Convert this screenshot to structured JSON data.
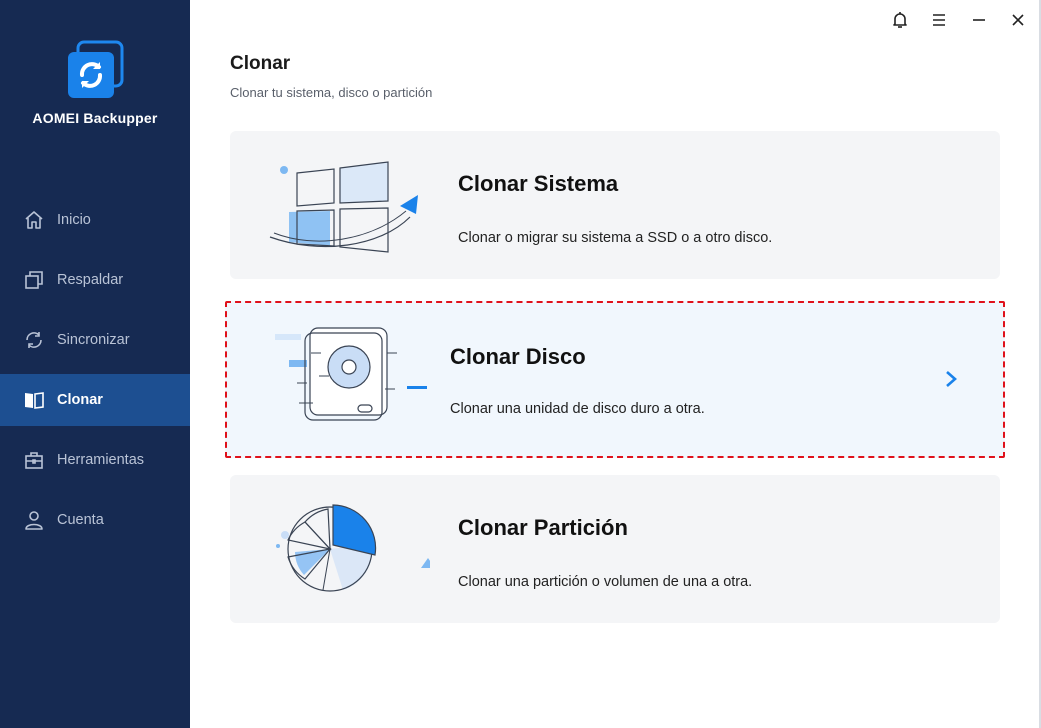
{
  "app": {
    "name": "AOMEI Backupper",
    "logo_icon": "sync-arrows-icon"
  },
  "sidebar": {
    "items": [
      {
        "label": "Inicio",
        "icon": "home-icon",
        "active": false
      },
      {
        "label": "Respaldar",
        "icon": "backup-icon",
        "active": false
      },
      {
        "label": "Sincronizar",
        "icon": "sync-icon",
        "active": false
      },
      {
        "label": "Clonar",
        "icon": "clone-icon",
        "active": true
      },
      {
        "label": "Herramientas",
        "icon": "toolbox-icon",
        "active": false
      },
      {
        "label": "Cuenta",
        "icon": "user-icon",
        "active": false
      }
    ]
  },
  "titlebar": {
    "buttons": [
      "bell-icon",
      "menu-icon",
      "minimize-icon",
      "close-icon"
    ]
  },
  "page": {
    "title": "Clonar",
    "subtitle": "Clonar tu sistema, disco o partición"
  },
  "options": [
    {
      "title": "Clonar Sistema",
      "description": "Clonar o migrar su sistema a SSD o a otro disco.",
      "icon": "windows-migrate-illustration",
      "selected": false
    },
    {
      "title": "Clonar Disco",
      "description": "Clonar una unidad de disco duro a otra.",
      "icon": "hard-disk-illustration",
      "selected": true
    },
    {
      "title": "Clonar Partición",
      "description": "Clonar una partición o volumen de una a otra.",
      "icon": "pie-partition-illustration",
      "selected": false
    }
  ],
  "colors": {
    "sidebar_bg": "#162a52",
    "sidebar_active": "#1d4f91",
    "accent": "#1a82ea",
    "selection_border": "#e0111b",
    "card_bg": "#f4f5f7"
  }
}
